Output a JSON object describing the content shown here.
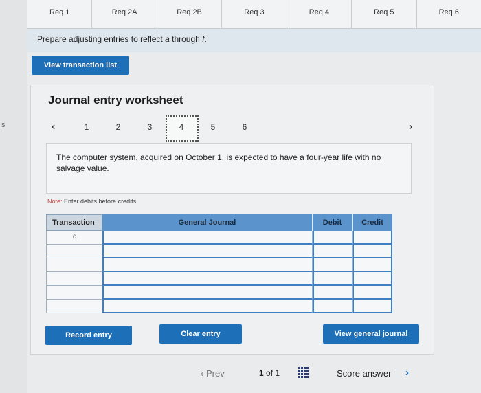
{
  "tabs": [
    "Req 1",
    "Req 2A",
    "Req 2B",
    "Req 3",
    "Req 4",
    "Req 5",
    "Req 6"
  ],
  "left_edge_char": "s",
  "instruction": {
    "prefix": "Prepare adjusting entries to reflect ",
    "italic_a": "a",
    "middle": " through ",
    "italic_f": "f",
    "suffix": "."
  },
  "view_transaction_list_label": "View transaction list",
  "worksheet": {
    "title": "Journal entry worksheet",
    "pager": {
      "prev_arrow": "‹",
      "next_arrow": "›",
      "pages": [
        "1",
        "2",
        "3",
        "4",
        "5",
        "6"
      ],
      "active_page": "4"
    },
    "description": "The computer system, acquired on October 1, is expected to have a four-year life with no salvage value.",
    "note_label": "Note:",
    "note_text": " Enter debits before credits.",
    "table": {
      "headers": {
        "transaction": "Transaction",
        "journal": "General Journal",
        "debit": "Debit",
        "credit": "Credit"
      },
      "rows": [
        {
          "transaction": "d.",
          "journal": "",
          "debit": "",
          "credit": ""
        },
        {
          "transaction": "",
          "journal": "",
          "debit": "",
          "credit": ""
        },
        {
          "transaction": "",
          "journal": "",
          "debit": "",
          "credit": ""
        },
        {
          "transaction": "",
          "journal": "",
          "debit": "",
          "credit": ""
        },
        {
          "transaction": "",
          "journal": "",
          "debit": "",
          "credit": ""
        },
        {
          "transaction": "",
          "journal": "",
          "debit": "",
          "credit": ""
        }
      ]
    },
    "buttons": {
      "record": "Record entry",
      "clear": "Clear entry",
      "view_journal": "View general journal"
    }
  },
  "bottom_nav": {
    "prev_label": "Prev",
    "prev_arrow": "‹",
    "page_current": "1",
    "page_of": "of",
    "page_total": "1",
    "score_label": "Score answer",
    "score_arrow": "›",
    "grid_icon": "grid-icon"
  },
  "colors": {
    "button_blue": "#1d6fb8",
    "header_blue": "#5b93cd"
  }
}
